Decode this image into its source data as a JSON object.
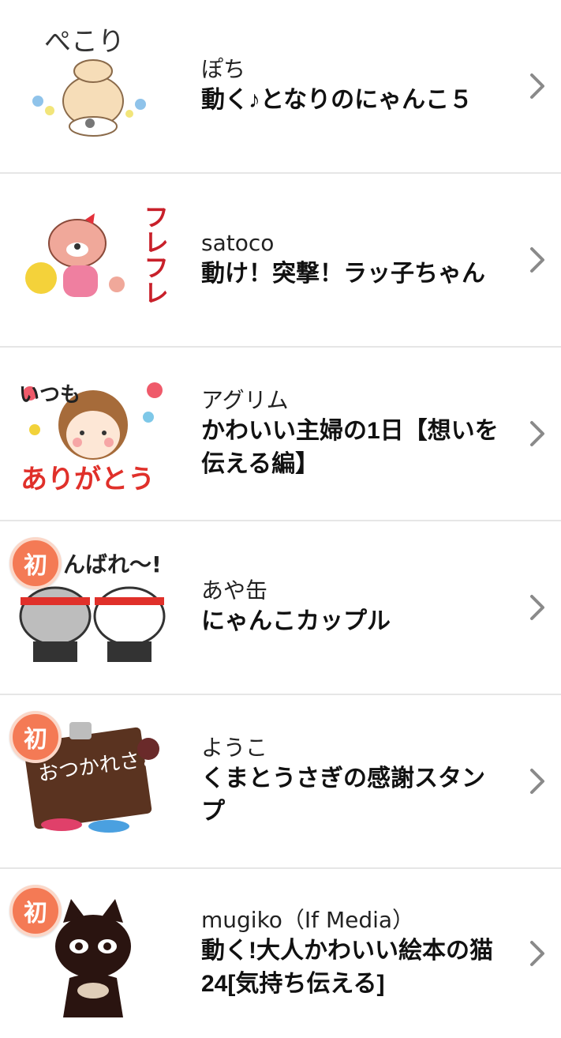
{
  "colors": {
    "badge": "#f47a55",
    "divider": "#e6e6e6",
    "chevron": "#8a8a8a"
  },
  "items": [
    {
      "author": "ぽち",
      "title": "動く♪となりのにゃんこ５",
      "badge": "",
      "thumb_icon": "cat-bowing-sticker-icon"
    },
    {
      "author": "satoco",
      "title": "動け！突撃！ラッ子ちゃん",
      "badge": "",
      "thumb_icon": "otter-cheerleader-sticker-icon"
    },
    {
      "author": "アグリム",
      "title": "かわいい主婦の1日【想いを伝える編】",
      "badge": "",
      "thumb_icon": "girl-thankyou-sticker-icon"
    },
    {
      "author": "あや缶",
      "title": "にゃんこカップル",
      "badge": "初",
      "thumb_icon": "cat-couple-sticker-icon"
    },
    {
      "author": "ようこ",
      "title": "くまとうさぎの感謝スタンプ",
      "badge": "初",
      "thumb_icon": "chocolate-board-sticker-icon"
    },
    {
      "author": "mugiko（If Media）",
      "title": "動く!大人かわいい絵本の猫24[気持ち伝える]",
      "badge": "初",
      "thumb_icon": "black-cat-sticker-icon"
    }
  ],
  "thumb_text": {
    "item0": "ぺこり",
    "item1": "フレフレ",
    "item2_top": "いつも",
    "item2_bottom": "ありがとう",
    "item3": "んばれ〜!",
    "item4": "おつかれさまです"
  }
}
